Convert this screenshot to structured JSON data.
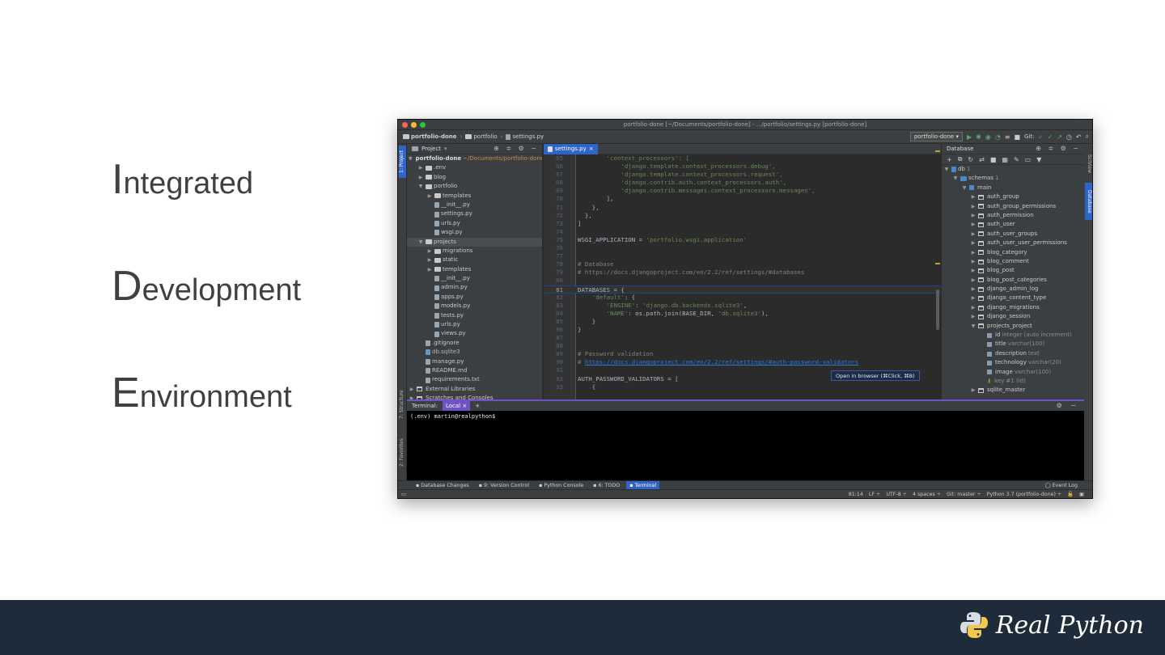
{
  "slide": {
    "words": [
      {
        "initial": "I",
        "rest": "ntegrated"
      },
      {
        "initial": "D",
        "rest": "evelopment"
      },
      {
        "initial": "E",
        "rest": "nvironment"
      }
    ],
    "brand": "Real Python",
    "footer_color": "#1d2b3a"
  },
  "ide": {
    "window_title": "portfolio-done [~/Documents/portfolio-done] - .../portfolio/settings.py [portfolio-done]",
    "breadcrumb": [
      "portfolio-done",
      "portfolio",
      "settings.py"
    ],
    "run_config": "portfolio-done",
    "git_label": "Git:",
    "left_tabs": [
      "1: Project",
      "7: Structure",
      "2: Favorites"
    ],
    "right_tabs": [
      "SciView",
      "Database"
    ],
    "project_panel": {
      "title": "Project",
      "root_name": "portfolio-done",
      "root_path": "~/Documents/portfolio-done",
      "items": [
        {
          "name": ".env",
          "depth": 1,
          "kind": "folder",
          "arrow": "▶"
        },
        {
          "name": "blog",
          "depth": 1,
          "kind": "folder",
          "arrow": "▶"
        },
        {
          "name": "portfolio",
          "depth": 1,
          "kind": "folder",
          "arrow": "▼"
        },
        {
          "name": "templates",
          "depth": 2,
          "kind": "folder",
          "arrow": "▶"
        },
        {
          "name": "__init__.py",
          "depth": 2,
          "kind": "file",
          "arrow": ""
        },
        {
          "name": "settings.py",
          "depth": 2,
          "kind": "file",
          "arrow": ""
        },
        {
          "name": "urls.py",
          "depth": 2,
          "kind": "file",
          "arrow": ""
        },
        {
          "name": "wsgi.py",
          "depth": 2,
          "kind": "file",
          "arrow": ""
        },
        {
          "name": "projects",
          "depth": 1,
          "kind": "folder",
          "arrow": "▼",
          "highlight": true
        },
        {
          "name": "migrations",
          "depth": 2,
          "kind": "folder",
          "arrow": "▶"
        },
        {
          "name": "static",
          "depth": 2,
          "kind": "folder",
          "arrow": "▶"
        },
        {
          "name": "templates",
          "depth": 2,
          "kind": "folder",
          "arrow": "▶"
        },
        {
          "name": "__init__.py",
          "depth": 2,
          "kind": "file",
          "arrow": ""
        },
        {
          "name": "admin.py",
          "depth": 2,
          "kind": "file",
          "arrow": ""
        },
        {
          "name": "apps.py",
          "depth": 2,
          "kind": "file",
          "arrow": ""
        },
        {
          "name": "models.py",
          "depth": 2,
          "kind": "file",
          "arrow": ""
        },
        {
          "name": "tests.py",
          "depth": 2,
          "kind": "file",
          "arrow": ""
        },
        {
          "name": "urls.py",
          "depth": 2,
          "kind": "file",
          "arrow": ""
        },
        {
          "name": "views.py",
          "depth": 2,
          "kind": "file",
          "arrow": ""
        },
        {
          "name": ".gitignore",
          "depth": 1,
          "kind": "file",
          "arrow": ""
        },
        {
          "name": "db.sqlite3",
          "depth": 1,
          "kind": "db",
          "arrow": ""
        },
        {
          "name": "manage.py",
          "depth": 1,
          "kind": "file",
          "arrow": ""
        },
        {
          "name": "README.md",
          "depth": 1,
          "kind": "file",
          "arrow": ""
        },
        {
          "name": "requirements.txt",
          "depth": 1,
          "kind": "file",
          "arrow": ""
        },
        {
          "name": "External Libraries",
          "depth": 0,
          "kind": "lib",
          "arrow": "▶"
        },
        {
          "name": "Scratches and Consoles",
          "depth": 0,
          "kind": "lib",
          "arrow": "▶"
        }
      ]
    },
    "editor": {
      "tab": "settings.py",
      "lines": [
        {
          "n": "65",
          "parts": [
            {
              "t": "        ",
              "c": "plain"
            },
            {
              "t": "'context_processors': [",
              "c": "str"
            }
          ]
        },
        {
          "n": "66",
          "parts": [
            {
              "t": "            'django.template.context_processors.debug',",
              "c": "str"
            }
          ]
        },
        {
          "n": "67",
          "parts": [
            {
              "t": "            'django.template.context_processors.request',",
              "c": "str"
            }
          ]
        },
        {
          "n": "68",
          "parts": [
            {
              "t": "            'django.contrib.auth.context_processors.auth',",
              "c": "str"
            }
          ]
        },
        {
          "n": "69",
          "parts": [
            {
              "t": "            'django.contrib.messages.context_processors.messages',",
              "c": "str"
            }
          ]
        },
        {
          "n": "70",
          "parts": [
            {
              "t": "        ],",
              "c": "plain"
            }
          ]
        },
        {
          "n": "71",
          "parts": [
            {
              "t": "    },",
              "c": "plain"
            }
          ]
        },
        {
          "n": "72",
          "parts": [
            {
              "t": "  },",
              "c": "plain"
            }
          ]
        },
        {
          "n": "73",
          "parts": [
            {
              "t": "]",
              "c": "plain"
            }
          ]
        },
        {
          "n": "74",
          "parts": [
            {
              "t": "",
              "c": "plain"
            }
          ]
        },
        {
          "n": "75",
          "parts": [
            {
              "t": "WSGI_APPLICATION = ",
              "c": "plain"
            },
            {
              "t": "'portfolio.wsgi.application'",
              "c": "str"
            }
          ]
        },
        {
          "n": "76",
          "parts": [
            {
              "t": "",
              "c": "plain"
            }
          ]
        },
        {
          "n": "77",
          "parts": [
            {
              "t": "",
              "c": "plain"
            }
          ]
        },
        {
          "n": "78",
          "parts": [
            {
              "t": "# Database",
              "c": "com"
            }
          ]
        },
        {
          "n": "79",
          "parts": [
            {
              "t": "# https://docs.djangoproject.com/en/2.2/ref/settings/#databases",
              "c": "com"
            }
          ]
        },
        {
          "n": "80",
          "parts": [
            {
              "t": "",
              "c": "plain"
            }
          ]
        },
        {
          "n": "81",
          "parts": [
            {
              "t": "DATABASES = {",
              "c": "plain"
            }
          ],
          "current": true
        },
        {
          "n": "82",
          "parts": [
            {
              "t": "    ",
              "c": "plain"
            },
            {
              "t": "'default'",
              "c": "str"
            },
            {
              "t": ": {",
              "c": "plain"
            }
          ]
        },
        {
          "n": "83",
          "parts": [
            {
              "t": "        ",
              "c": "plain"
            },
            {
              "t": "'ENGINE'",
              "c": "str"
            },
            {
              "t": ": ",
              "c": "plain"
            },
            {
              "t": "'django.db.backends.sqlite3'",
              "c": "str"
            },
            {
              "t": ",",
              "c": "plain"
            }
          ]
        },
        {
          "n": "84",
          "parts": [
            {
              "t": "        ",
              "c": "plain"
            },
            {
              "t": "'NAME'",
              "c": "str"
            },
            {
              "t": ": os.path.join(BASE_DIR, ",
              "c": "plain"
            },
            {
              "t": "'db.sqlite3'",
              "c": "str"
            },
            {
              "t": "),",
              "c": "plain"
            }
          ]
        },
        {
          "n": "85",
          "parts": [
            {
              "t": "    }",
              "c": "plain"
            }
          ]
        },
        {
          "n": "86",
          "parts": [
            {
              "t": "}",
              "c": "plain"
            }
          ]
        },
        {
          "n": "87",
          "parts": [
            {
              "t": "",
              "c": "plain"
            }
          ]
        },
        {
          "n": "88",
          "parts": [
            {
              "t": "",
              "c": "plain"
            }
          ]
        },
        {
          "n": "89",
          "parts": [
            {
              "t": "# Password validation",
              "c": "com"
            }
          ]
        },
        {
          "n": "90",
          "parts": [
            {
              "t": "# ",
              "c": "com"
            },
            {
              "t": "https://docs.djangoproject.com/en/2.2/ref/settings/#auth-password-validators",
              "c": "link"
            }
          ]
        },
        {
          "n": "91",
          "parts": [
            {
              "t": "",
              "c": "plain"
            }
          ]
        },
        {
          "n": "92",
          "parts": [
            {
              "t": "AUTH_PASSWORD_VALIDATORS = [",
              "c": "plain"
            }
          ]
        },
        {
          "n": "93",
          "parts": [
            {
              "t": "    {",
              "c": "plain"
            }
          ]
        }
      ],
      "tooltip": "Open in browser (⌘Click, ⌘B)"
    },
    "database_panel": {
      "title": "Database",
      "items": [
        {
          "name": "db",
          "extra": "1",
          "depth": 0,
          "kind": "db",
          "arrow": "▼"
        },
        {
          "name": "schemas",
          "extra": "1",
          "depth": 1,
          "kind": "folder",
          "arrow": "▼"
        },
        {
          "name": "main",
          "extra": "",
          "depth": 2,
          "kind": "schema",
          "arrow": "▼"
        },
        {
          "name": "auth_group",
          "extra": "",
          "depth": 3,
          "kind": "table",
          "arrow": "▶"
        },
        {
          "name": "auth_group_permissions",
          "extra": "",
          "depth": 3,
          "kind": "table",
          "arrow": "▶"
        },
        {
          "name": "auth_permission",
          "extra": "",
          "depth": 3,
          "kind": "table",
          "arrow": "▶"
        },
        {
          "name": "auth_user",
          "extra": "",
          "depth": 3,
          "kind": "table",
          "arrow": "▶"
        },
        {
          "name": "auth_user_groups",
          "extra": "",
          "depth": 3,
          "kind": "table",
          "arrow": "▶"
        },
        {
          "name": "auth_user_user_permissions",
          "extra": "",
          "depth": 3,
          "kind": "table",
          "arrow": "▶"
        },
        {
          "name": "blog_category",
          "extra": "",
          "depth": 3,
          "kind": "table",
          "arrow": "▶"
        },
        {
          "name": "blog_comment",
          "extra": "",
          "depth": 3,
          "kind": "table",
          "arrow": "▶"
        },
        {
          "name": "blog_post",
          "extra": "",
          "depth": 3,
          "kind": "table",
          "arrow": "▶"
        },
        {
          "name": "blog_post_categories",
          "extra": "",
          "depth": 3,
          "kind": "table",
          "arrow": "▶"
        },
        {
          "name": "django_admin_log",
          "extra": "",
          "depth": 3,
          "kind": "table",
          "arrow": "▶"
        },
        {
          "name": "django_content_type",
          "extra": "",
          "depth": 3,
          "kind": "table",
          "arrow": "▶"
        },
        {
          "name": "django_migrations",
          "extra": "",
          "depth": 3,
          "kind": "table",
          "arrow": "▶"
        },
        {
          "name": "django_session",
          "extra": "",
          "depth": 3,
          "kind": "table",
          "arrow": "▶"
        },
        {
          "name": "projects_project",
          "extra": "",
          "depth": 3,
          "kind": "table",
          "arrow": "▼"
        },
        {
          "name": "id",
          "extra": "integer (auto increment)",
          "depth": 4,
          "kind": "column",
          "arrow": ""
        },
        {
          "name": "title",
          "extra": "varchar(100)",
          "depth": 4,
          "kind": "column",
          "arrow": ""
        },
        {
          "name": "description",
          "extra": "text",
          "depth": 4,
          "kind": "column",
          "arrow": ""
        },
        {
          "name": "technology",
          "extra": "varchar(20)",
          "depth": 4,
          "kind": "column",
          "arrow": ""
        },
        {
          "name": "image",
          "extra": "varchar(100)",
          "depth": 4,
          "kind": "column",
          "arrow": ""
        },
        {
          "name": "key",
          "extra": "#1 (id)",
          "depth": 4,
          "kind": "key",
          "arrow": ""
        },
        {
          "name": "sqlite_master",
          "extra": "",
          "depth": 3,
          "kind": "table",
          "arrow": "▶"
        }
      ]
    },
    "terminal": {
      "label": "Terminal:",
      "tab": "Local",
      "prompt": "(.env) martin@realpython$"
    },
    "tool_buttons": [
      {
        "label": "Database Changes",
        "active": false
      },
      {
        "label": "9: Version Control",
        "active": false
      },
      {
        "label": "Python Console",
        "active": false
      },
      {
        "label": "6: TODO",
        "active": false
      },
      {
        "label": "Terminal",
        "active": true
      }
    ],
    "event_log": "Event Log",
    "status": [
      "81:14",
      "LF ÷",
      "UTF-8 ÷",
      "4 spaces ÷",
      "Git: master ÷",
      "Python 3.7 (portfolio-done) ÷"
    ]
  }
}
